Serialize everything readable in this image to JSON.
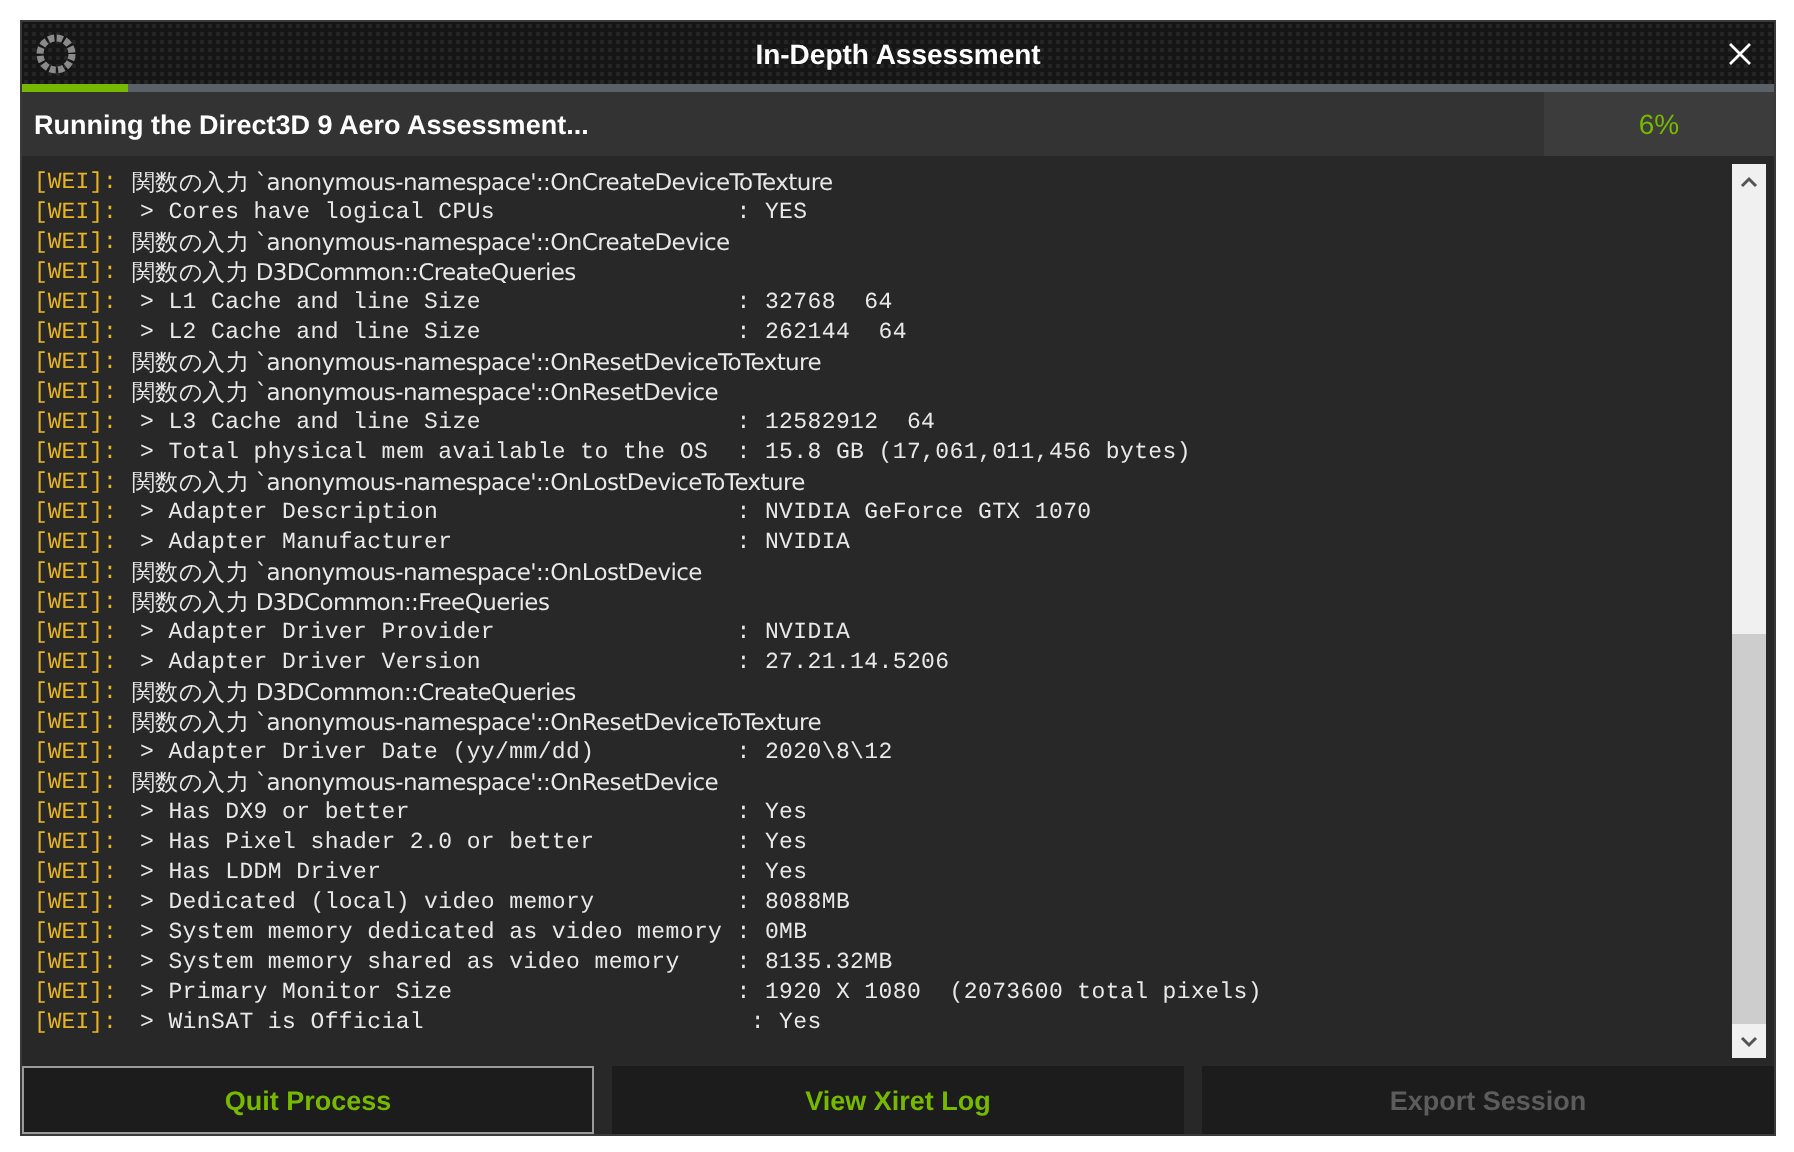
{
  "window": {
    "title": "In-Depth Assessment"
  },
  "progress": {
    "level": 0.06
  },
  "status": {
    "text": "Running the Direct3D 9 Aero Assessment...",
    "percent": "6%"
  },
  "log": [
    {
      "kind": "call",
      "prefix": "[WEI]:",
      "text": "関数の入力 `anonymous-namespace'::OnCreateDeviceToTexture"
    },
    {
      "kind": "value",
      "prefix": "[WEI]:",
      "text": "> Cores have logical CPUs                 : YES"
    },
    {
      "kind": "call",
      "prefix": "[WEI]:",
      "text": "関数の入力 `anonymous-namespace'::OnCreateDevice"
    },
    {
      "kind": "call",
      "prefix": "[WEI]:",
      "text": "関数の入力 D3DCommon::CreateQueries"
    },
    {
      "kind": "value",
      "prefix": "[WEI]:",
      "text": "> L1 Cache and line Size                  : 32768  64"
    },
    {
      "kind": "value",
      "prefix": "[WEI]:",
      "text": "> L2 Cache and line Size                  : 262144  64"
    },
    {
      "kind": "call",
      "prefix": "[WEI]:",
      "text": "関数の入力 `anonymous-namespace'::OnResetDeviceToTexture"
    },
    {
      "kind": "call",
      "prefix": "[WEI]:",
      "text": "関数の入力 `anonymous-namespace'::OnResetDevice"
    },
    {
      "kind": "value",
      "prefix": "[WEI]:",
      "text": "> L3 Cache and line Size                  : 12582912  64"
    },
    {
      "kind": "value",
      "prefix": "[WEI]:",
      "text": "> Total physical mem available to the OS  : 15.8 GB (17,061,011,456 bytes)"
    },
    {
      "kind": "call",
      "prefix": "[WEI]:",
      "text": "関数の入力 `anonymous-namespace'::OnLostDeviceToTexture"
    },
    {
      "kind": "value",
      "prefix": "[WEI]:",
      "text": "> Adapter Description                     : NVIDIA GeForce GTX 1070"
    },
    {
      "kind": "value",
      "prefix": "[WEI]:",
      "text": "> Adapter Manufacturer                    : NVIDIA"
    },
    {
      "kind": "call",
      "prefix": "[WEI]:",
      "text": "関数の入力 `anonymous-namespace'::OnLostDevice"
    },
    {
      "kind": "call",
      "prefix": "[WEI]:",
      "text": "関数の入力 D3DCommon::FreeQueries"
    },
    {
      "kind": "value",
      "prefix": "[WEI]:",
      "text": "> Adapter Driver Provider                 : NVIDIA"
    },
    {
      "kind": "value",
      "prefix": "[WEI]:",
      "text": "> Adapter Driver Version                  : 27.21.14.5206"
    },
    {
      "kind": "call",
      "prefix": "[WEI]:",
      "text": "関数の入力 D3DCommon::CreateQueries"
    },
    {
      "kind": "call",
      "prefix": "[WEI]:",
      "text": "関数の入力 `anonymous-namespace'::OnResetDeviceToTexture"
    },
    {
      "kind": "value",
      "prefix": "[WEI]:",
      "text": "> Adapter Driver Date (yy/mm/dd)          : 2020\\8\\12"
    },
    {
      "kind": "call",
      "prefix": "[WEI]:",
      "text": "関数の入力 `anonymous-namespace'::OnResetDevice"
    },
    {
      "kind": "value",
      "prefix": "[WEI]:",
      "text": "> Has DX9 or better                       : Yes"
    },
    {
      "kind": "value",
      "prefix": "[WEI]:",
      "text": "> Has Pixel shader 2.0 or better          : Yes"
    },
    {
      "kind": "value",
      "prefix": "[WEI]:",
      "text": "> Has LDDM Driver                         : Yes"
    },
    {
      "kind": "value",
      "prefix": "[WEI]:",
      "text": "> Dedicated (local) video memory          : 8088MB"
    },
    {
      "kind": "value",
      "prefix": "[WEI]:",
      "text": "> System memory dedicated as video memory : 0MB"
    },
    {
      "kind": "value",
      "prefix": "[WEI]:",
      "text": "> System memory shared as video memory    : 8135.32MB"
    },
    {
      "kind": "value",
      "prefix": "[WEI]:",
      "text": "> Primary Monitor Size                    : 1920 X 1080  (2073600 total pixels)"
    },
    {
      "kind": "value",
      "prefix": "[WEI]:",
      "text": "> WinSAT is Official                       : Yes"
    }
  ],
  "buttons": [
    {
      "label": "Quit Process",
      "disabled": false,
      "focused": true
    },
    {
      "label": "View Xiret Log",
      "disabled": false,
      "focused": false
    },
    {
      "label": "Export Session",
      "disabled": true,
      "focused": false
    }
  ]
}
